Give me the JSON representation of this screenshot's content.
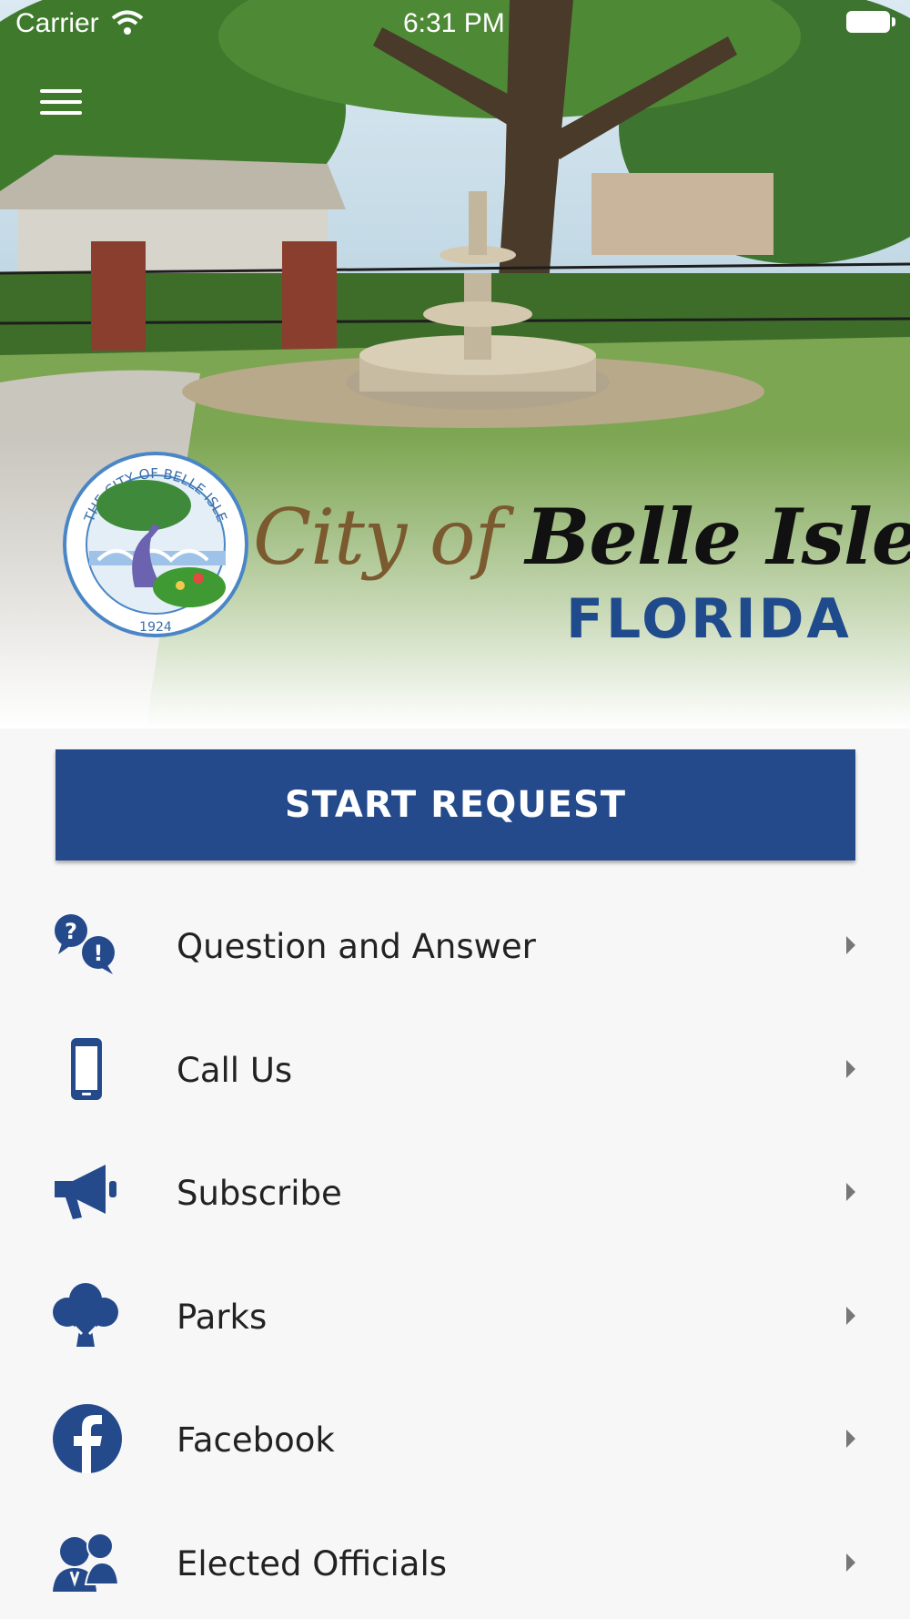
{
  "status_bar": {
    "carrier": "Carrier",
    "time": "6:31 PM"
  },
  "header": {
    "seal_text": "THE CITY OF BELLE ISLE",
    "seal_year": "1924",
    "brand_city_of": "City of ",
    "brand_belle_isle": "Belle Isle",
    "brand_state": "FLORIDA"
  },
  "start_request": {
    "label": "START REQUEST"
  },
  "menu_items": [
    {
      "label": "Question and Answer",
      "icon": "question-answer-icon"
    },
    {
      "label": "Call Us",
      "icon": "phone-icon"
    },
    {
      "label": "Subscribe",
      "icon": "megaphone-icon"
    },
    {
      "label": "Parks",
      "icon": "tree-icon"
    },
    {
      "label": "Facebook",
      "icon": "facebook-icon"
    },
    {
      "label": "Elected Officials",
      "icon": "officials-icon"
    }
  ],
  "colors": {
    "brand_blue": "#244a8c",
    "script_brown": "#7a5a2e",
    "background": "#f7f7f7"
  }
}
